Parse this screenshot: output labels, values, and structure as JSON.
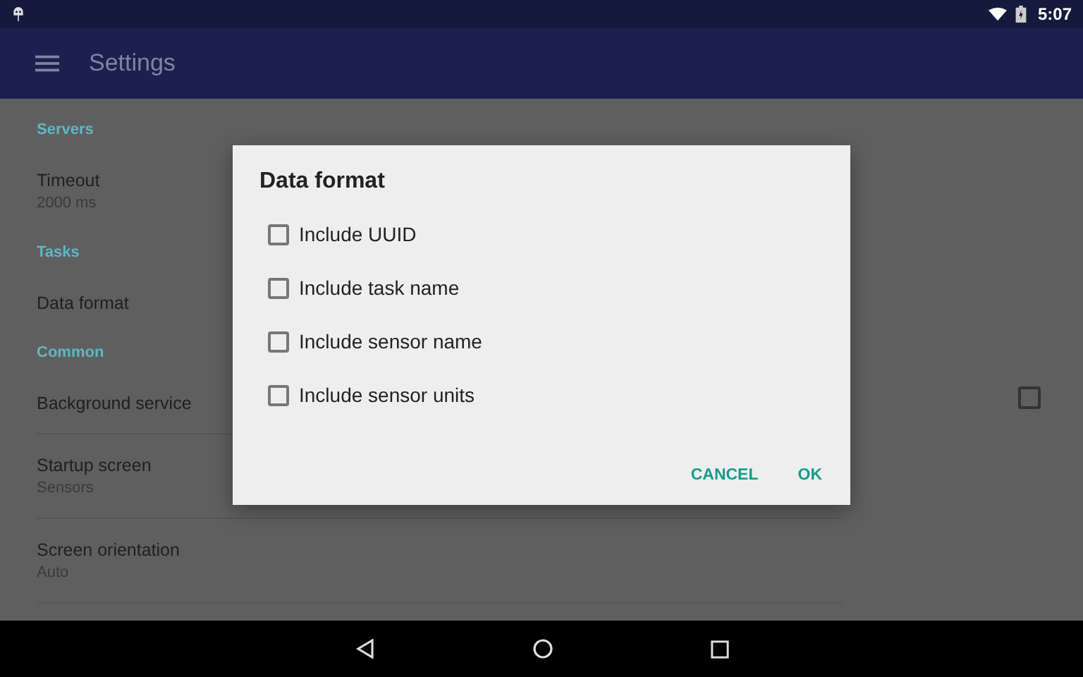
{
  "status_bar": {
    "time": "5:07"
  },
  "app_bar": {
    "title": "Settings"
  },
  "sections": [
    {
      "header": "Servers",
      "divided": false,
      "items": [
        {
          "kind": "text",
          "title": "Timeout",
          "summary": "2000 ms"
        }
      ]
    },
    {
      "header": "Tasks",
      "divided": false,
      "items": [
        {
          "kind": "text",
          "title": "Data format"
        }
      ]
    },
    {
      "header": "Common",
      "divided": true,
      "items": [
        {
          "kind": "checkbox",
          "title": "Background service",
          "checked": false
        },
        {
          "kind": "text",
          "title": "Startup screen",
          "summary": "Sensors"
        },
        {
          "kind": "text",
          "title": "Screen orientation",
          "summary": "Auto"
        }
      ]
    }
  ],
  "dialog": {
    "title": "Data format",
    "options": [
      {
        "label": "Include UUID",
        "checked": false
      },
      {
        "label": "Include task name",
        "checked": false
      },
      {
        "label": "Include sensor name",
        "checked": false
      },
      {
        "label": "Include sensor units",
        "checked": false
      }
    ],
    "buttons": [
      "CANCEL",
      "OK"
    ]
  }
}
